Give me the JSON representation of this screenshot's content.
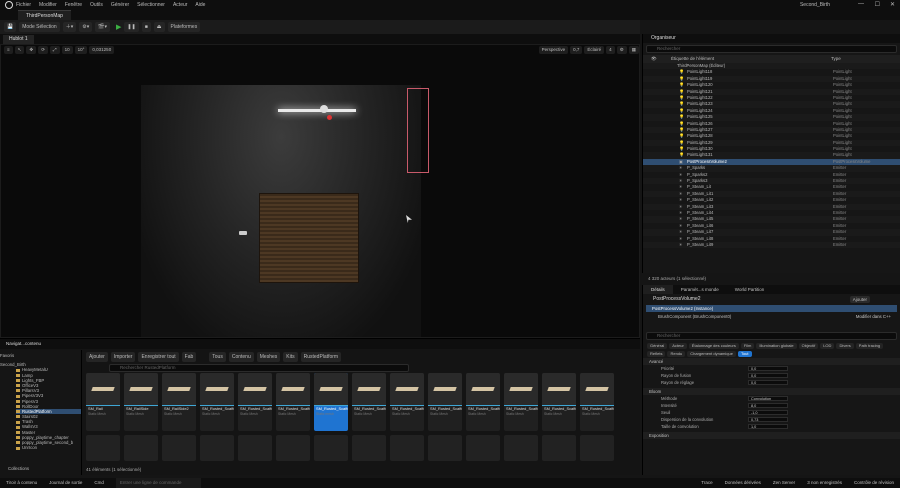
{
  "app": {
    "menu": [
      "Fichier",
      "Modifier",
      "Fenêtre",
      "Outils",
      "Générer",
      "Sélectionner",
      "Acteur",
      "Aide"
    ],
    "project_name": "Second_Birth",
    "map_tab": "ThirdPersonMap"
  },
  "toolbar": {
    "mode": "Mode Sélection",
    "platforms": "Plateformes"
  },
  "viewport": {
    "tab": "Hublot 1",
    "perspective": "Perspective",
    "lit": "Éclairé",
    "speed": "0,7",
    "scale": "0,031250",
    "grid": "10",
    "angle": "10°",
    "cam": "4"
  },
  "outliner": {
    "title": "Organiseur",
    "search_placeholder": "Rechercher",
    "col_label": "Étiquette de l'élément",
    "col_type": "Type",
    "root": "ThirdPersonMap (Éditeur)",
    "rows": [
      {
        "label": "PointLight118",
        "type": "PointLight",
        "icon": "💡"
      },
      {
        "label": "PointLight119",
        "type": "PointLight",
        "icon": "💡"
      },
      {
        "label": "PointLight120",
        "type": "PointLight",
        "icon": "💡"
      },
      {
        "label": "PointLight121",
        "type": "PointLight",
        "icon": "💡"
      },
      {
        "label": "PointLight122",
        "type": "PointLight",
        "icon": "💡"
      },
      {
        "label": "PointLight123",
        "type": "PointLight",
        "icon": "💡"
      },
      {
        "label": "PointLight124",
        "type": "PointLight",
        "icon": "💡"
      },
      {
        "label": "PointLight125",
        "type": "PointLight",
        "icon": "💡"
      },
      {
        "label": "PointLight126",
        "type": "PointLight",
        "icon": "💡"
      },
      {
        "label": "PointLight127",
        "type": "PointLight",
        "icon": "💡"
      },
      {
        "label": "PointLight128",
        "type": "PointLight",
        "icon": "💡"
      },
      {
        "label": "PointLight129",
        "type": "PointLight",
        "icon": "💡"
      },
      {
        "label": "PointLight130",
        "type": "PointLight",
        "icon": "💡"
      },
      {
        "label": "PointLight131",
        "type": "PointLight",
        "icon": "💡"
      },
      {
        "label": "PostProcessVolume2",
        "type": "PostProcessVolume",
        "icon": "▣",
        "selected": true
      },
      {
        "label": "P_Sparks",
        "type": "Emitter",
        "icon": "✳"
      },
      {
        "label": "P_Sparks2",
        "type": "Emitter",
        "icon": "✳"
      },
      {
        "label": "P_Sparks3",
        "type": "Emitter",
        "icon": "✳"
      },
      {
        "label": "P_Steam_Lit",
        "type": "Emitter",
        "icon": "✳"
      },
      {
        "label": "P_Steam_Lit1",
        "type": "Emitter",
        "icon": "✳"
      },
      {
        "label": "P_Steam_Lit2",
        "type": "Emitter",
        "icon": "✳"
      },
      {
        "label": "P_Steam_Lit3",
        "type": "Emitter",
        "icon": "✳"
      },
      {
        "label": "P_Steam_Lit4",
        "type": "Emitter",
        "icon": "✳"
      },
      {
        "label": "P_Steam_Lit5",
        "type": "Emitter",
        "icon": "✳"
      },
      {
        "label": "P_Steam_Lit6",
        "type": "Emitter",
        "icon": "✳"
      },
      {
        "label": "P_Steam_Lit7",
        "type": "Emitter",
        "icon": "✳"
      },
      {
        "label": "P_Steam_Lit8",
        "type": "Emitter",
        "icon": "✳"
      },
      {
        "label": "P_Steam_Lit9",
        "type": "Emitter",
        "icon": "✳"
      }
    ],
    "footer": "4 320 acteurs (1 sélectionné)"
  },
  "details": {
    "tabs": [
      "Détails",
      "Paramèt...s monde",
      "World Partition"
    ],
    "object": "PostProcessVolume2",
    "add": "Ajouter",
    "instance": "PostProcessVolume2 (Instance)",
    "component": "BrushComponent (BrushComponent0)",
    "edit_cpp": "Modifier dans C++",
    "search": "Rechercher",
    "chips": [
      "Général",
      "Acteur",
      "Étalonnage des couleurs",
      "Film",
      "Illumination globale",
      "Objectif",
      "LOD",
      "Divers",
      "Path tracing",
      "Reflets",
      "Rendu",
      "Chargement dynamique",
      "Tout"
    ],
    "chip_active": "Tout",
    "section_advanced": "Avancé",
    "adv_props": [
      {
        "label": "Priorité",
        "value": "0,0"
      },
      {
        "label": "Rayon de fusion",
        "value": "0,0"
      },
      {
        "label": "Rayon de réglage",
        "value": "0,0"
      }
    ],
    "section_bloom": "Bloom",
    "bloom_props": [
      {
        "label": "Méthode",
        "value": "Convolution"
      },
      {
        "label": "Intensité",
        "value": "8,0"
      },
      {
        "label": "Seuil",
        "value": "-1,0"
      },
      {
        "label": "Dispersion de la convolution",
        "value": "0,73"
      },
      {
        "label": "Taille de convolution",
        "value": "1,0"
      }
    ],
    "section_exposure": "Exposition"
  },
  "content": {
    "tab": "Navigat...contenu",
    "fav": "Favoris",
    "project": "Second_Birth",
    "add": "Ajouter",
    "import": "Importer",
    "save": "Enregistrer tout",
    "fab": "Fab",
    "path": [
      "Tous",
      "Contenu",
      "Meshes",
      "Kits",
      "RustedPlatform"
    ],
    "search_placeholder": "Rechercher RustedPlatform",
    "tree": [
      {
        "label": "HeavyMetalU",
        "folder": true
      },
      {
        "label": "Lamp",
        "folder": true
      },
      {
        "label": "Lights_FBP",
        "folder": true
      },
      {
        "label": "OfficeV3",
        "folder": true
      },
      {
        "label": "PillarsV3",
        "folder": true
      },
      {
        "label": "PipesV3V3",
        "folder": true
      },
      {
        "label": "PipesV3",
        "folder": true
      },
      {
        "label": "RollDoor",
        "folder": true
      },
      {
        "label": "RustedPlatform",
        "folder": true,
        "selected": true
      },
      {
        "label": "Stairs02",
        "folder": true
      },
      {
        "label": "Trash",
        "folder": true
      },
      {
        "label": "WallsV3",
        "folder": true
      },
      {
        "label": "Master",
        "folder": true
      },
      {
        "label": "poppy_playtime_chapter",
        "folder": true
      },
      {
        "label": "poppy_playtime_second_b",
        "folder": true
      },
      {
        "label": "UnrIcon",
        "folder": true
      }
    ],
    "collections": "Collections",
    "assets": [
      {
        "name": "SM_Rail",
        "type": "Static Mesh"
      },
      {
        "name": "SM_RailSide",
        "type": "Static Mesh"
      },
      {
        "name": "SM_RailSide2",
        "type": "Static Mesh"
      },
      {
        "name": "SM_Rusted_Scaffold_Kit_Bracket_A_2x2M",
        "type": "Static Mesh"
      },
      {
        "name": "SM_Rusted_Scaffold_Kit_Bracket_A_2x2M",
        "type": "Static Mesh"
      },
      {
        "name": "SM_Rusted_Scaffold_Kit_Bracket_B_2x2M",
        "type": "Static Mesh"
      },
      {
        "name": "SM_Rusted_Scaffold_Kit_Corner_Platform",
        "type": "Static mesh",
        "selected": true
      },
      {
        "name": "SM_Rusted_Scaffold_Kit_Corner_Platform",
        "type": "Static Mesh"
      },
      {
        "name": "SM_Rusted_Scaffold_Kit_Damaged_...",
        "type": "Static Mesh"
      },
      {
        "name": "SM_Rusted_Scaffold_Kit_Damaged_...",
        "type": "Static Mesh"
      },
      {
        "name": "SM_Rusted_Scaffold_Kit_Damaged_...",
        "type": "Static Mesh"
      },
      {
        "name": "SM_Rusted_Scaffold_Kit_Damaged_...",
        "type": "Static Mesh"
      },
      {
        "name": "SM_Rusted_Scaffold_Kit_Damaged_...",
        "type": "Static Mesh"
      },
      {
        "name": "SM_Rusted_Scaffold_Kit_Damaged_...",
        "type": "Static Mesh"
      }
    ],
    "footer": "41 éléments (1 sélectionné)"
  },
  "statusbar": {
    "drawer": "Tiroir à contenu",
    "log": "Journal de sortie",
    "cmd": "Cmd",
    "cmd_placeholder": "Entrer une ligne de commande",
    "trace": "Trace",
    "derived": "Données dérivées",
    "zen": "Zen Server",
    "unsaved": "3 non enregistrés",
    "source": "Contrôle de révision"
  }
}
